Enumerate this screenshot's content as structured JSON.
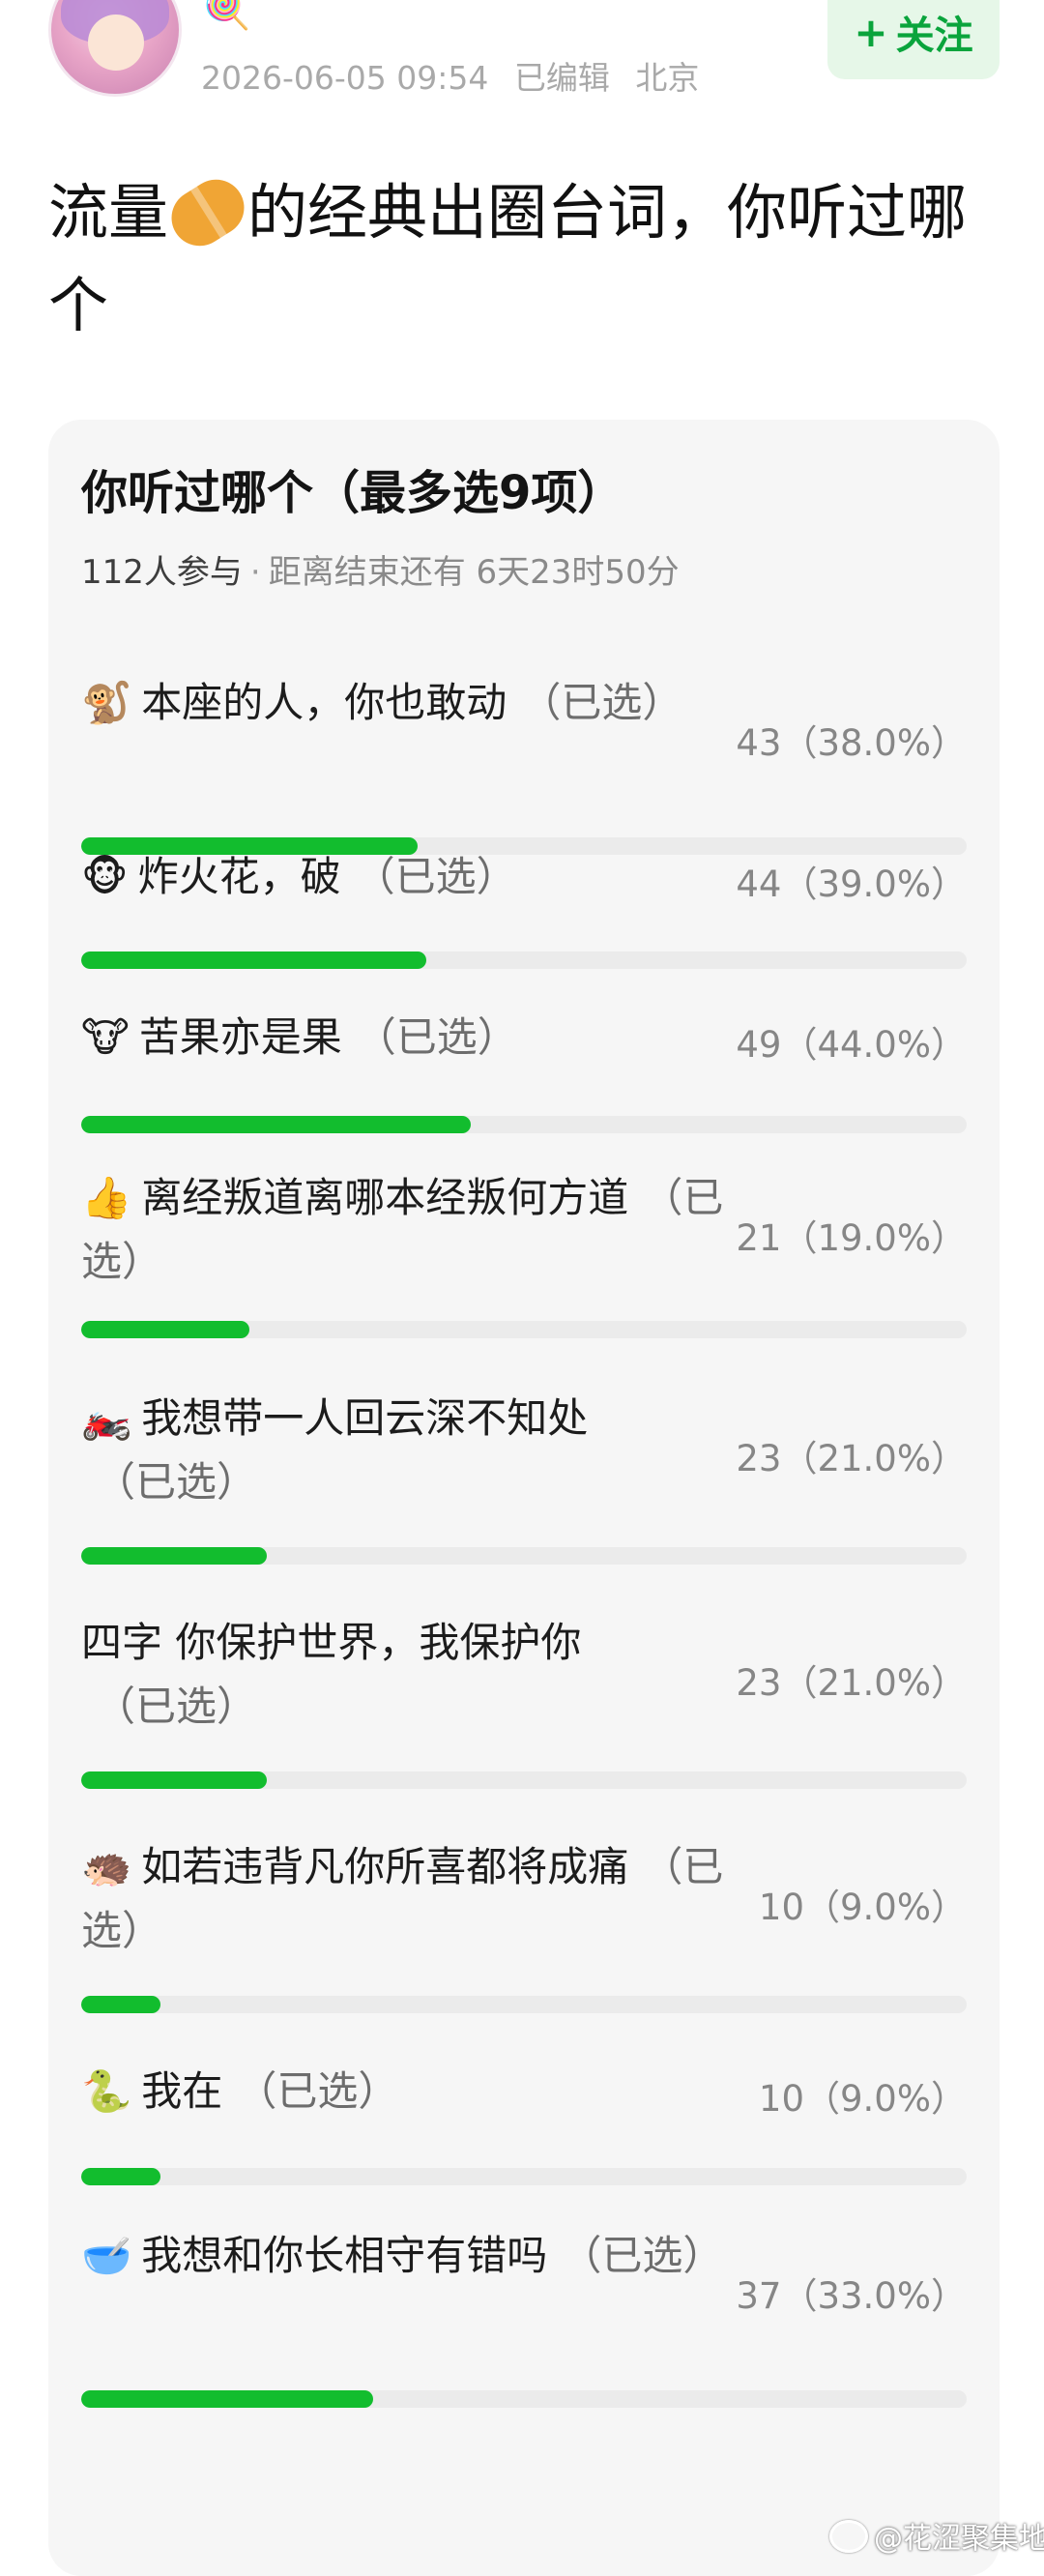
{
  "post": {
    "timestamp": "2026-06-05 09:54",
    "edited": "已编辑",
    "location": "北京",
    "follow_label": "关注",
    "title_before": "流量",
    "title_after": "的经典出圈台词，你听过哪个",
    "icon_badge": "lollipop-icon"
  },
  "poll": {
    "title": "你听过哪个（最多选9项）",
    "participants": "112人参与",
    "separator": "·",
    "remaining": "距离结束还有 6天23时50分",
    "options": [
      {
        "emoji": "🐒",
        "text": "本座的人，你也敢动",
        "selected": "（已选）",
        "count": "43（38.0%）",
        "percent": 38.0
      },
      {
        "emoji": "🐵",
        "text": "炸火花，破",
        "selected": "（已选）",
        "count": "44（39.0%）",
        "percent": 39.0
      },
      {
        "emoji": "🐮",
        "text": "苦果亦是果",
        "selected": "（已选）",
        "count": "49（44.0%）",
        "percent": 44.0
      },
      {
        "emoji": "👍",
        "text": "离经叛道离哪本经叛何方道",
        "selected": "（已选）",
        "count": "21（19.0%）",
        "percent": 19.0
      },
      {
        "emoji": "🏍️",
        "text": "我想带一人回云深不知处",
        "selected": "（已选）",
        "count": "23（21.0%）",
        "percent": 21.0
      },
      {
        "emoji": "",
        "text": "四字 你保护世界，我保护你",
        "selected": "（已选）",
        "count": "23（21.0%）",
        "percent": 21.0
      },
      {
        "emoji": "🦔",
        "text": "如若违背凡你所喜都将成痛",
        "selected": "（已选）",
        "count": "10（9.0%）",
        "percent": 9.0
      },
      {
        "emoji": "🐍",
        "text": "我在",
        "selected": "（已选）",
        "count": "10（9.0%）",
        "percent": 9.0
      },
      {
        "emoji": "🥣",
        "text": "我想和你长相守有错吗",
        "selected": "（已选）",
        "count": "37（33.0%）",
        "percent": 33.0
      }
    ]
  },
  "watermark": "@花涩聚集地",
  "colors": {
    "accent_green": "#12bd2e",
    "follow_bg": "#e6f7e8",
    "follow_text": "#0aa43c",
    "card_bg": "#f6f6f6"
  }
}
